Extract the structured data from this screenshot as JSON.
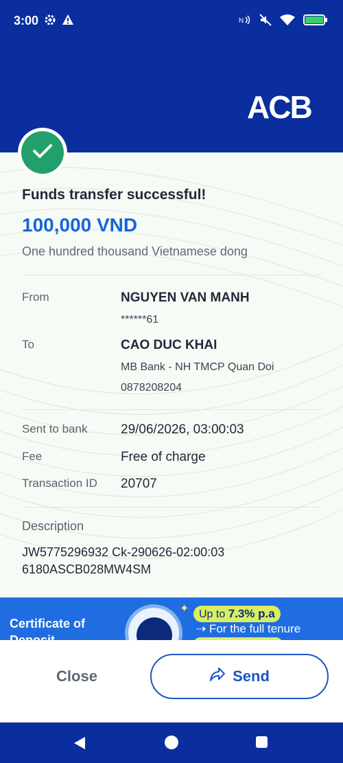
{
  "status_bar": {
    "time": "3:00",
    "icons": [
      "gear-icon",
      "warning-icon",
      "nfc-icon",
      "mute-icon",
      "wifi-icon",
      "battery-icon"
    ]
  },
  "brand": {
    "logo_text": "ACB",
    "color": "#0a2e9e"
  },
  "receipt": {
    "title": "Funds transfer successful!",
    "amount": "100,000 VND",
    "amount_words": "One hundred thousand Vietnamese dong",
    "from_label": "From",
    "from_name": "NGUYEN VAN MANH",
    "from_account": "******61",
    "to_label": "To",
    "to_name": "CAO DUC KHAI",
    "to_bank": "MB Bank - NH TMCP Quan Doi",
    "to_account": "0878208204",
    "sent_label": "Sent to bank",
    "sent_value": "29/06/2026, 03:00:03",
    "fee_label": "Fee",
    "fee_value": "Free of charge",
    "txn_label": "Transaction ID",
    "txn_value": "20707",
    "desc_label": "Description",
    "desc_line1": "JW5775296932 Ck-290626-02:00:03",
    "desc_line2": "6180ASCB028MW4SM"
  },
  "promo": {
    "title_line1": "Certificate of",
    "title_line2": "Deposit",
    "rate_prefix": "Up to ",
    "rate_value": "7.3% p.a",
    "tenure": "For the full tenure"
  },
  "actions": {
    "close_label": "Close",
    "send_label": "Send"
  },
  "colors": {
    "success": "#22a06b",
    "amount": "#1565d8",
    "send": "#1a55c8",
    "promo": "#1f6de0"
  }
}
